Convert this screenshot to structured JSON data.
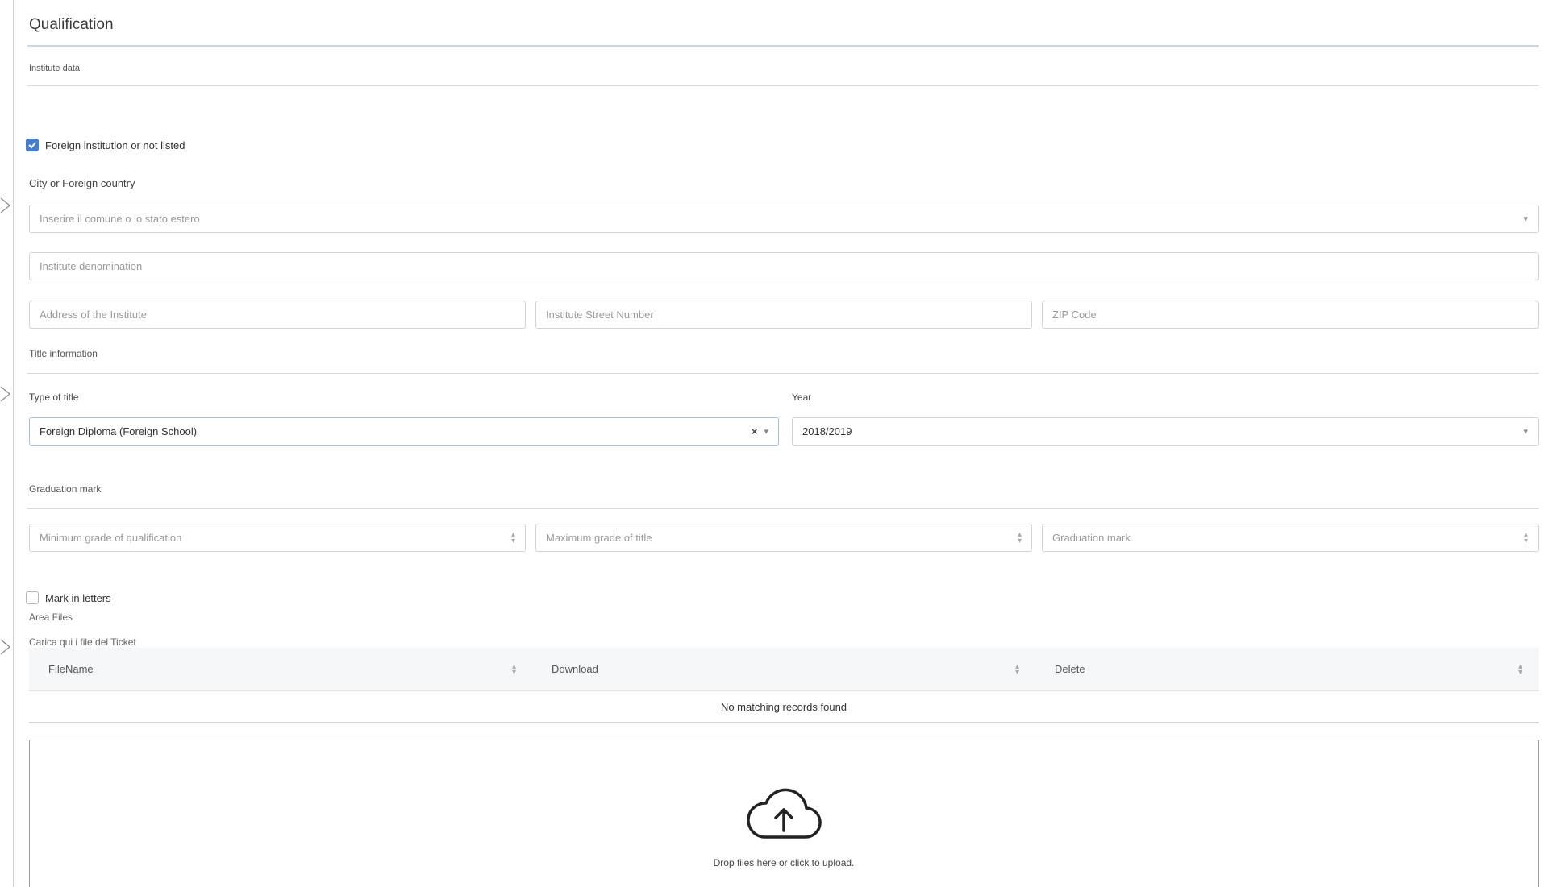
{
  "section": {
    "title": "Qualification",
    "institute_label": "Institute data"
  },
  "foreign_checkbox": {
    "label": "Foreign institution or not listed",
    "checked": true
  },
  "city": {
    "label": "City or Foreign country",
    "placeholder": "Inserire il comune o lo stato estero"
  },
  "institute": {
    "denomination_placeholder": "Institute denomination",
    "address_placeholder": "Address of the Institute",
    "street_number_placeholder": "Institute Street Number",
    "zip_placeholder": "ZIP Code"
  },
  "title_info": {
    "section_label": "Title information",
    "type_label": "Type of title",
    "type_value": "Foreign Diploma (Foreign School)",
    "year_label": "Year",
    "year_value": "2018/2019"
  },
  "graduation": {
    "section_label": "Graduation mark",
    "min_placeholder": "Minimum grade of qualification",
    "max_placeholder": "Maximum grade of title",
    "mark_placeholder": "Graduation mark"
  },
  "mark_letters": {
    "label": "Mark in letters",
    "checked": false
  },
  "files": {
    "area_label": "Area Files",
    "upload_label": "Carica qui i file del Ticket",
    "columns": [
      "FileName",
      "Download",
      "Delete"
    ],
    "empty_message": "No matching records found",
    "dropzone_text": "Drop files here or click to upload."
  },
  "icons": {
    "checkbox_checked": "check-icon",
    "dropdown": "caret-down-icon",
    "clear": "clear-x-icon",
    "spinner": "number-spinner-icon",
    "sort": "sort-icon",
    "upload": "cloud-upload-icon",
    "rail": "chevron-right-icon"
  },
  "colors": {
    "accent": "#3f7dd6",
    "section_rule": "#c9d6e3",
    "focus_border": "#9fc0ea"
  }
}
